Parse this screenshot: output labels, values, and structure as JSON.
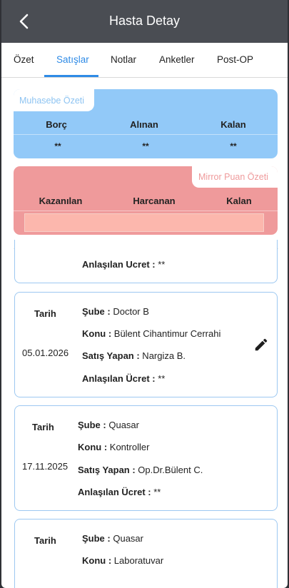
{
  "appbar": {
    "title": "Hasta Detay"
  },
  "tabs": [
    {
      "label": "Özet"
    },
    {
      "label": "Satışlar"
    },
    {
      "label": "Notlar"
    },
    {
      "label": "Anketler"
    },
    {
      "label": "Post-OP"
    }
  ],
  "accounting": {
    "title": "Muhasebe Özeti",
    "headers": [
      "Borç",
      "Alınan",
      "Kalan"
    ],
    "values": [
      "**",
      "**",
      "**"
    ]
  },
  "mirror": {
    "title": "Mirror Puan Özeti",
    "headers": [
      "Kazanılan",
      "Harcanan",
      "Kalan"
    ]
  },
  "sales": [
    {
      "agreed_label": "Anlaşılan Ucret :",
      "agreed": " **"
    },
    {
      "date_label": "Tarih",
      "date": "05.01.2026",
      "branch_label": "Şube :",
      "branch": " Doctor B",
      "topic_label": "Konu :",
      "topic": " Bülent Cihantimur Cerrahi",
      "seller_label": "Satış Yapan :",
      "seller": " Nargiza B.",
      "agreed_label": "Anlaşılan Ücret :",
      "agreed": " **",
      "icons": {
        "edit": "pencil-icon"
      }
    },
    {
      "date_label": "Tarih",
      "date": "17.11.2025",
      "branch_label": "Şube :",
      "branch": " Quasar",
      "topic_label": "Konu :",
      "topic": " Kontroller",
      "seller_label": "Satış Yapan :",
      "seller": " Op.Dr.Bülent C.",
      "agreed_label": "Anlaşılan Ücret :",
      "agreed": " **"
    },
    {
      "date_label": "Tarih",
      "branch_label": "Şube :",
      "branch": " Quasar",
      "topic_label": "Konu :",
      "topic": " Laboratuvar"
    }
  ],
  "colors": {
    "appbar": "#4a4d53",
    "accent": "#2f8be6",
    "accounting_bg": "#92c9f8",
    "mirror_bg": "#ef9a9b",
    "card_border": "#9dc8f1"
  }
}
